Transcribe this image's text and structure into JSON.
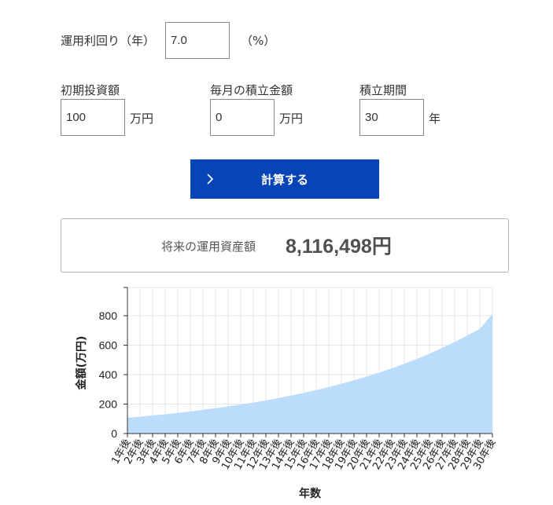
{
  "form": {
    "rate": {
      "label": "運用利回り（年）",
      "value": "7.0",
      "unit": "（%）"
    },
    "initial": {
      "label": "初期投資額",
      "value": "100",
      "unit": "万円"
    },
    "monthly": {
      "label": "毎月の積立金額",
      "value": "0",
      "unit": "万円"
    },
    "period": {
      "label": "積立期間",
      "value": "30",
      "unit": "年"
    },
    "calc_button": {
      "label": "計算する",
      "icon": "chevron-right-icon"
    }
  },
  "result": {
    "label": "将来の運用資産額",
    "value": "8,116,498円"
  },
  "chart_data": {
    "type": "area",
    "xlabel": "年数",
    "ylabel": "金額(万円)",
    "ylim": [
      0,
      1000
    ],
    "yticks": [
      0,
      200,
      400,
      600,
      800
    ],
    "grid": true,
    "fill_color": "#bcdcfb",
    "categories": [
      "1年後",
      "2年後",
      "3年後",
      "4年後",
      "5年後",
      "6年後",
      "7年後",
      "8年後",
      "9年後",
      "10年後",
      "11年後",
      "12年後",
      "13年後",
      "14年後",
      "15年後",
      "16年後",
      "17年後",
      "18年後",
      "19年後",
      "20年後",
      "21年後",
      "22年後",
      "23年後",
      "24年後",
      "25年後",
      "26年後",
      "27年後",
      "28年後",
      "29年後",
      "30年後"
    ],
    "series": [
      {
        "values": [
          107,
          114,
          123,
          131,
          140,
          150,
          161,
          172,
          184,
          197,
          210,
          225,
          241,
          258,
          276,
          295,
          316,
          338,
          362,
          387,
          414,
          443,
          474,
          507,
          543,
          581,
          621,
          665,
          711,
          812
        ]
      }
    ]
  }
}
